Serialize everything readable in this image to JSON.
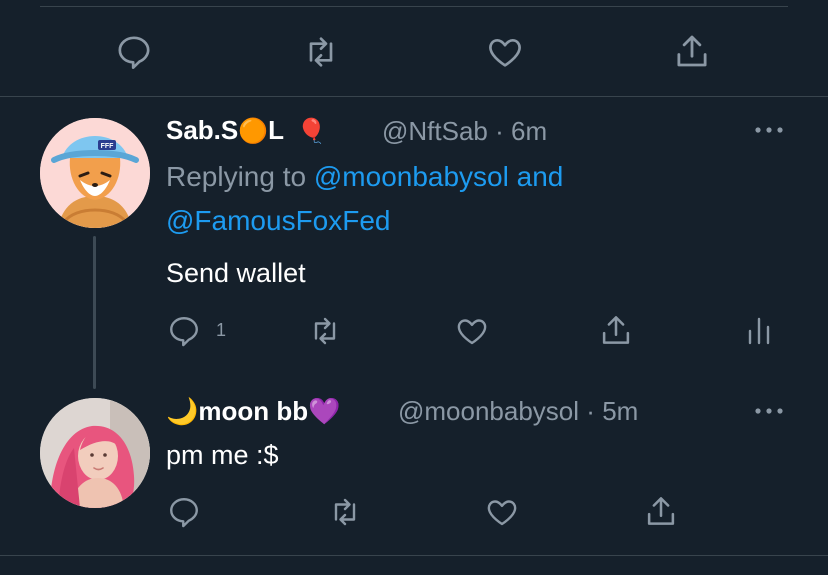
{
  "colors": {
    "background": "#15202b",
    "divider": "#38444d",
    "muted": "#8b98a5",
    "link": "#1d9bf0",
    "text": "#ffffff"
  },
  "top_tweet_actions": {
    "icons": [
      "reply-icon",
      "retweet-icon",
      "like-icon",
      "share-icon"
    ]
  },
  "reply_1": {
    "display_name_part1": "Sab.S",
    "display_name_emoji1": "🟠",
    "display_name_part2": "L",
    "display_name_emoji2": "🎈",
    "handle": "@NftSab",
    "separator": "·",
    "timestamp": "6m",
    "replying_prefix": "Replying to",
    "replying_user1": "@moonbabysol",
    "replying_joiner": "and",
    "replying_user2": "@FamousFoxFed",
    "text": "Send wallet",
    "reply_count": "1",
    "avatar": "fox-with-bucket-hat-avatar"
  },
  "reply_2": {
    "display_name_emoji1": "🌙",
    "display_name": "moon bb",
    "display_name_emoji2": "💜",
    "handle": "@moonbabysol",
    "separator": "·",
    "timestamp": "5m",
    "text": "pm me :$",
    "avatar": "pink-hair-person-avatar"
  }
}
